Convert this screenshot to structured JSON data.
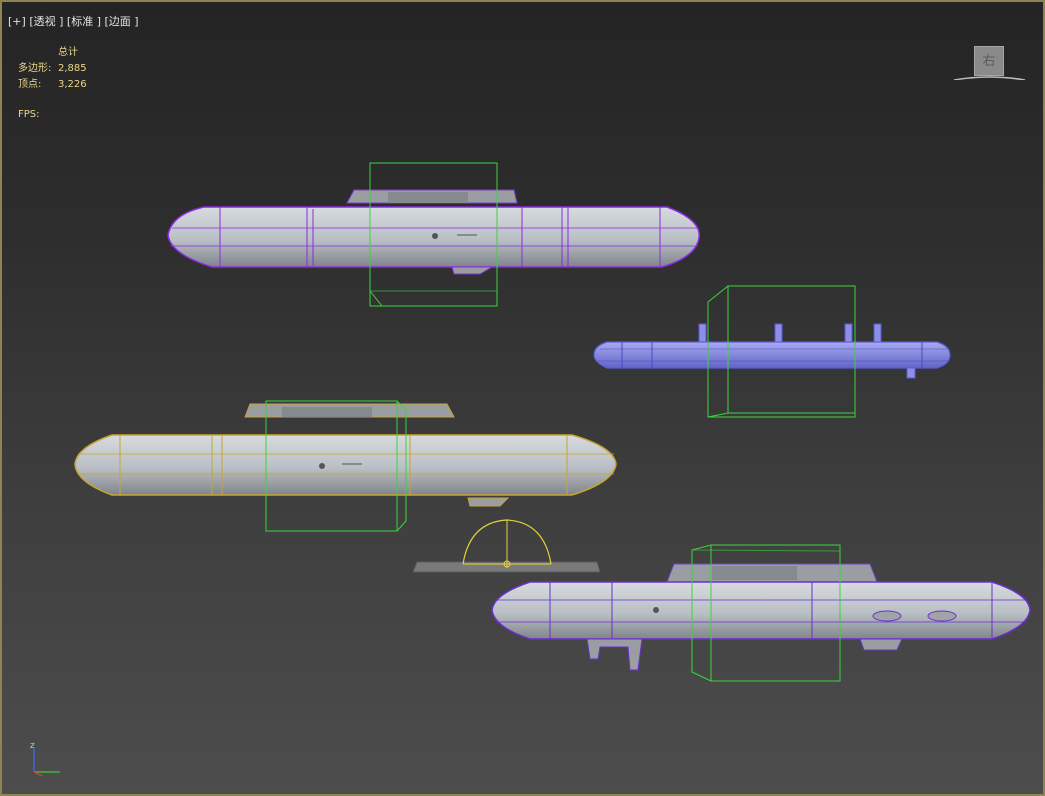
{
  "viewport": {
    "label_plus": "[+]",
    "label_view": "[透视 ]",
    "label_shading": "[标准 ]",
    "label_edge": "[边面 ]"
  },
  "stats": {
    "header": "总计",
    "polygons_label": "多边形:",
    "polygons_value": "2,885",
    "vertices_label": "顶点:",
    "vertices_value": "3,226",
    "fps_label": "FPS:"
  },
  "viewcube": {
    "face_label": "右"
  },
  "axis": {
    "z_label": "z"
  },
  "colors": {
    "border": "#8d8452",
    "stats_text": "#e8d68a",
    "selection_box": "#3bd43b",
    "wire_purple": "#8a2be2",
    "wire_blue": "#6a6ae0",
    "wire_yellow": "#c9a430"
  }
}
